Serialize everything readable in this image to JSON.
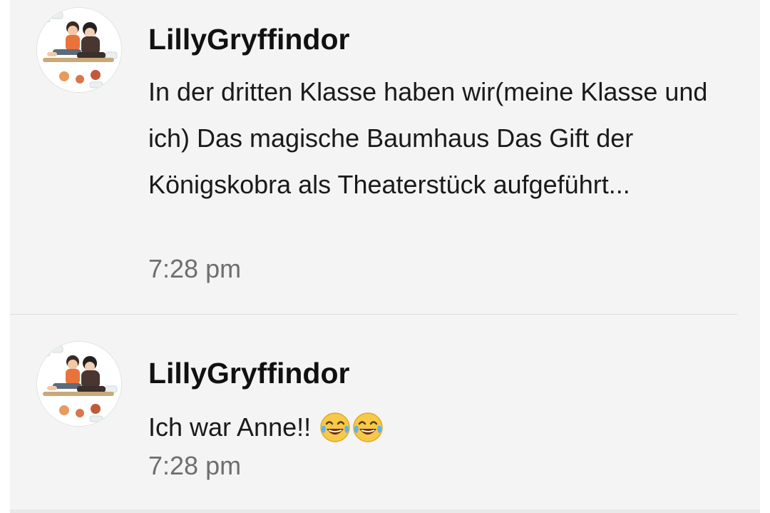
{
  "messages": [
    {
      "username": "LillyGryffindor",
      "text": "In der dritten Klasse haben wir(meine Klasse und ich) Das magische Baumhaus Das Gift der Königskobra als Theaterstück aufgeführt...",
      "time": "7:28 pm",
      "avatar_icon": "user-avatar-image"
    },
    {
      "username": "LillyGryffindor",
      "text": "Ich war Anne!!",
      "emojis": [
        "face-with-tears-of-joy-icon",
        "face-with-tears-of-joy-icon"
      ],
      "time": "7:28 pm",
      "avatar_icon": "user-avatar-image"
    }
  ],
  "colors": {
    "background": "#f4f4f4",
    "username": "#111111",
    "text": "#1a1a1a",
    "timestamp": "#6e6e6e",
    "divider": "#dedede",
    "emoji_face": "#f7c948"
  }
}
